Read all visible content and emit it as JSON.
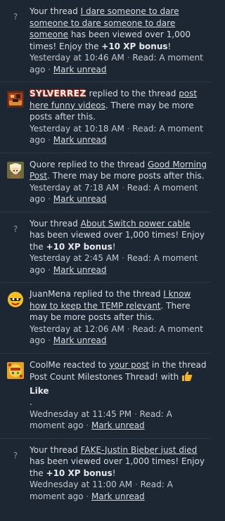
{
  "notifications": [
    {
      "avatar": "question-placeholder",
      "avatar_glyph": "?",
      "pre": "Your thread ",
      "link": "I dare someone to dare someone to dare someone to dare someone",
      "mid": " has been viewed over 1,000 times! Enjoy the ",
      "bold": "+10 XP bonus",
      "post": "!",
      "time": "Yesterday at 10:46 AM",
      "read": "Read: A moment ago",
      "action": "Mark unread"
    },
    {
      "avatar": "sylverrez-avatar",
      "user": "SYLVERREZ",
      "pre": " replied to the thread ",
      "link": "post here funny videos",
      "post": ". There may be more posts after this.",
      "time": "Yesterday at 10:18 AM",
      "read": "Read: A moment ago",
      "action": "Mark unread"
    },
    {
      "avatar": "quore-avatar",
      "user": "Quore",
      "pre": " replied to the thread ",
      "link": "Good Morning Post",
      "post": ". There may be more posts after this.",
      "time": "Yesterday at 7:18 AM",
      "read": "Read: A moment ago",
      "action": "Mark unread"
    },
    {
      "avatar": "question-placeholder",
      "avatar_glyph": "?",
      "pre": "Your thread ",
      "link": "About Switch power cable",
      "mid": " has been viewed over 1,000 times! Enjoy the ",
      "bold": "+10 XP bonus",
      "post": "!",
      "time": "Yesterday at 2:45 AM",
      "read": "Read: A moment ago",
      "action": "Mark unread"
    },
    {
      "avatar": "juanmena-avatar",
      "user": "JuanMena",
      "pre": " replied to the thread ",
      "link": "I know how to keep the TEMP relevant",
      "post": ". There may be more posts after this.",
      "time": "Yesterday at 12:06 AM",
      "read": "Read: A moment ago",
      "action": "Mark unread"
    },
    {
      "avatar": "coolme-avatar",
      "user": "CoolMe",
      "pre": " reacted to ",
      "link": "your post",
      "mid": " in the thread Post Count Milestones Thread! with ",
      "reaction_icon": "thumbs-up-icon",
      "reaction": "Like",
      "post": ".",
      "time": "Wednesday at 11:45 PM",
      "read": "Read: A moment ago",
      "action": "Mark unread"
    },
    {
      "avatar": "question-placeholder",
      "avatar_glyph": "?",
      "pre": "Your thread ",
      "link": "FAKE-Justin Bieber just died",
      "mid": " has been viewed over 1,000 times! Enjoy the ",
      "bold": "+10 XP bonus",
      "post": "!",
      "time": "Wednesday at 11:00 AM",
      "read": "Read: A moment ago",
      "action": "Mark unread"
    }
  ],
  "separator": "·",
  "colors": {
    "background": "#1d2633",
    "divider": "#2b3544",
    "text": "#d6dbe2",
    "like_icon": "#f2b420",
    "username_glow": "#d03a1c"
  }
}
